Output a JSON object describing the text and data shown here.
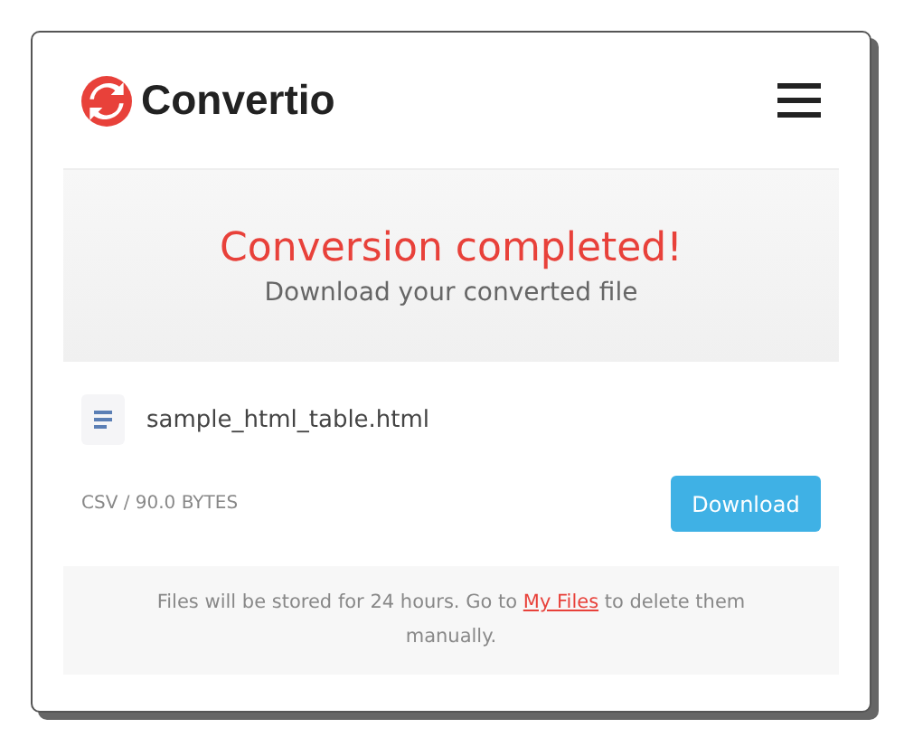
{
  "header": {
    "logo_text": "Convertio"
  },
  "hero": {
    "title": "Conversion completed!",
    "subtitle": "Download your converted file"
  },
  "file": {
    "name": "sample_html_table.html",
    "meta": "CSV / 90.0 BYTES",
    "button": "Download"
  },
  "footer": {
    "before": "Files will be stored for 24 hours. Go to",
    "link": "My Files",
    "after": "to delete them manually."
  }
}
